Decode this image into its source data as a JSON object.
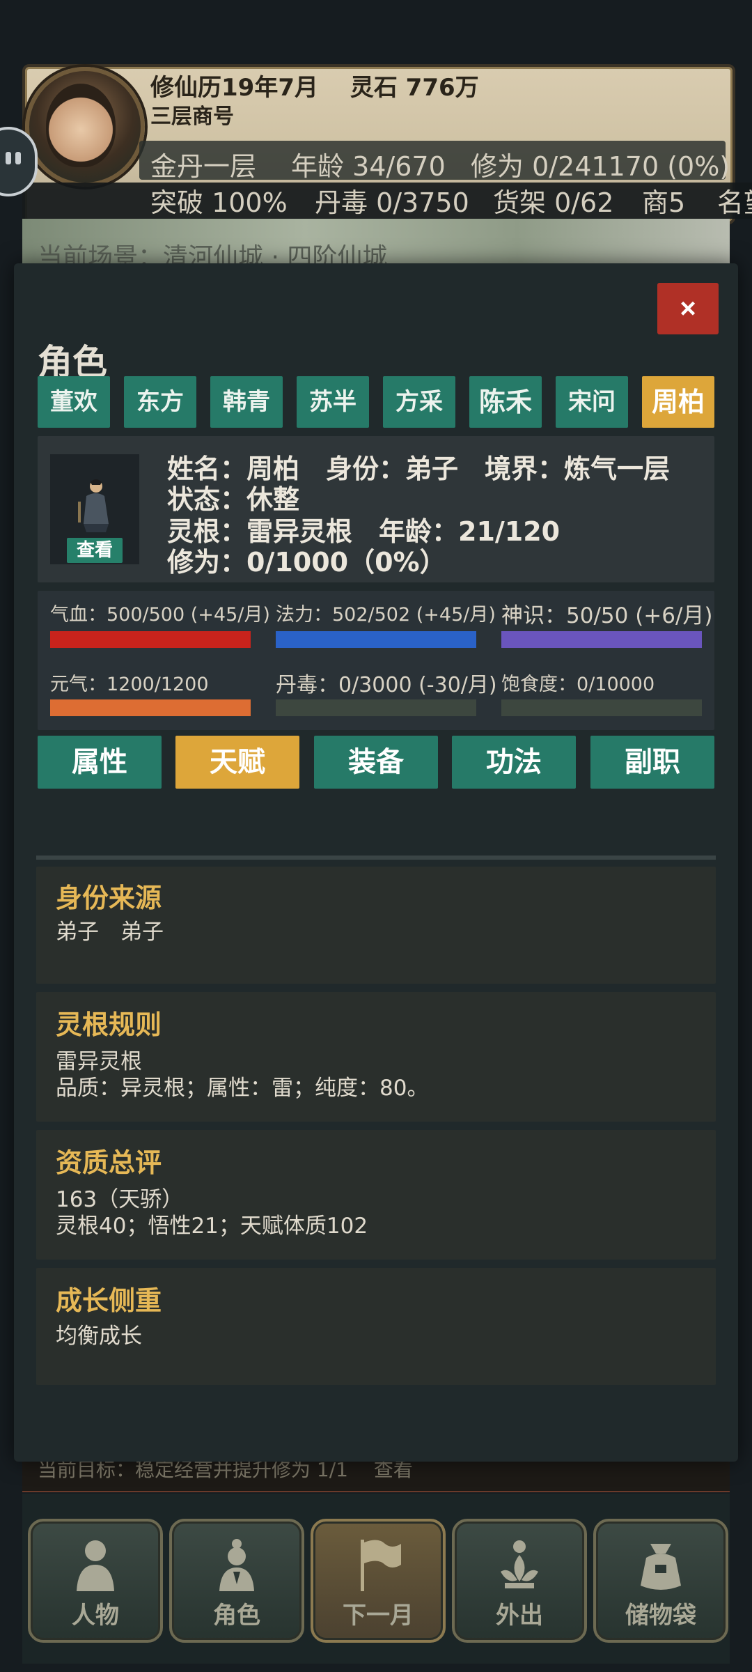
{
  "hud": {
    "calendar": "修仙历19年7月",
    "spirit_stones": "灵石 776万",
    "shop_name": "三层商号",
    "realm": "金丹一层",
    "age": "年龄 34/670",
    "cultivation": "修为 0/241170 (0%)",
    "breakthrough": "突破 100%",
    "pill_toxin": "丹毒 0/3750",
    "shelf": "货架 0/62",
    "merchant": "商5",
    "fame": "名望",
    "scene": "当前场景：清河仙城 · 四阶仙城",
    "goal": "当前目标：稳定经营并提升修为 1/1",
    "goal_view": "查看"
  },
  "modal": {
    "close_label": "×",
    "title": "角色",
    "tabs": [
      "董欢",
      "东方",
      "韩青",
      "苏半",
      "方采",
      "陈禾",
      "宋问",
      "周柏"
    ],
    "selected_tab": "周柏",
    "profile": {
      "line1": "姓名：周柏　身份：弟子　境界：炼气一层",
      "line2": "状态：休整",
      "line3": "灵根：雷异灵根　年龄：21/120",
      "line4": "修为：0/1000（0%）",
      "view_label": "查看"
    },
    "stats": [
      {
        "label": "气血：500/500 (+45/月)",
        "fill": 1.0,
        "color": "#c8231c"
      },
      {
        "label": "法力：502/502 (+45/月)",
        "fill": 1.0,
        "color": "#2a62c8"
      },
      {
        "label": "神识：50/50 (+6/月)",
        "fill": 1.0,
        "color": "#6a55bd"
      },
      {
        "label": "元气：1200/1200",
        "fill": 1.0,
        "color": "#dd6d33"
      },
      {
        "label": "丹毒：0/3000 (-30/月)",
        "fill": 0.0,
        "color": "#3d473f"
      },
      {
        "label": "饱食度：0/10000",
        "fill": 0.0,
        "color": "#3d473f"
      }
    ],
    "sub_tabs": [
      "属性",
      "天赋",
      "装备",
      "功法",
      "副职"
    ],
    "selected_sub_tab": "天赋",
    "sections": [
      {
        "title": "身份来源",
        "lines": [
          "弟子　弟子"
        ]
      },
      {
        "title": "灵根规则",
        "lines": [
          "雷异灵根",
          "品质：异灵根；属性：雷；纯度：80。"
        ]
      },
      {
        "title": "资质总评",
        "lines": [
          "163（天骄）",
          "灵根40；悟性21；天赋体质102"
        ]
      },
      {
        "title": "成长侧重",
        "lines": [
          "均衡成长"
        ]
      }
    ]
  },
  "nav": [
    {
      "label": "人物",
      "icon": "person-icon"
    },
    {
      "label": "角色",
      "icon": "character-icon"
    },
    {
      "label": "下一月",
      "icon": "flag-icon"
    },
    {
      "label": "外出",
      "icon": "lotus-icon"
    },
    {
      "label": "储物袋",
      "icon": "bag-icon"
    }
  ]
}
